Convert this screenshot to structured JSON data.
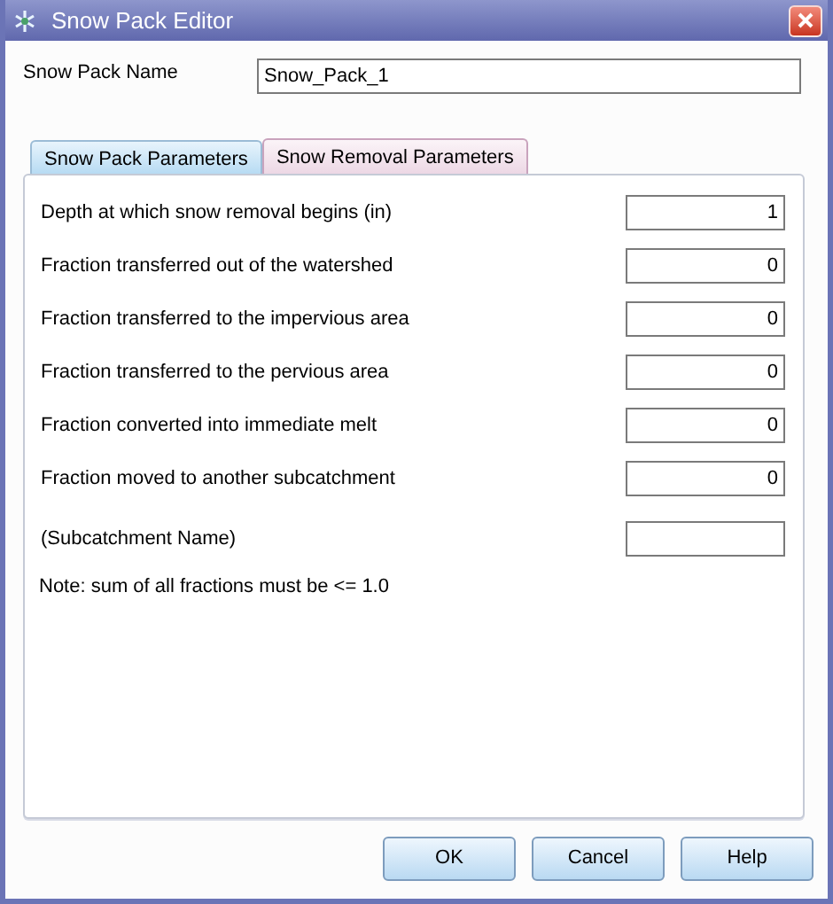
{
  "window": {
    "title": "Snow Pack Editor"
  },
  "name_field": {
    "label": "Snow Pack Name",
    "value": "Snow_Pack_1"
  },
  "tabs": [
    {
      "label": "Snow Pack Parameters",
      "selected": false
    },
    {
      "label": "Snow Removal Parameters",
      "selected": true
    }
  ],
  "fields": [
    {
      "label": "Depth at which snow removal begins (in)",
      "value": "1"
    },
    {
      "label": "Fraction transferred out of the watershed",
      "value": "0"
    },
    {
      "label": "Fraction transferred to the impervious area",
      "value": "0"
    },
    {
      "label": "Fraction transferred to the pervious area",
      "value": "0"
    },
    {
      "label": "Fraction converted into immediate melt",
      "value": "0"
    },
    {
      "label": "Fraction moved to another subcatchment",
      "value": "0"
    },
    {
      "label": "(Subcatchment Name)"
    }
  ],
  "note": "Note: sum of all fractions must be <= 1.0",
  "buttons": [
    "OK",
    "Cancel",
    "Help"
  ]
}
